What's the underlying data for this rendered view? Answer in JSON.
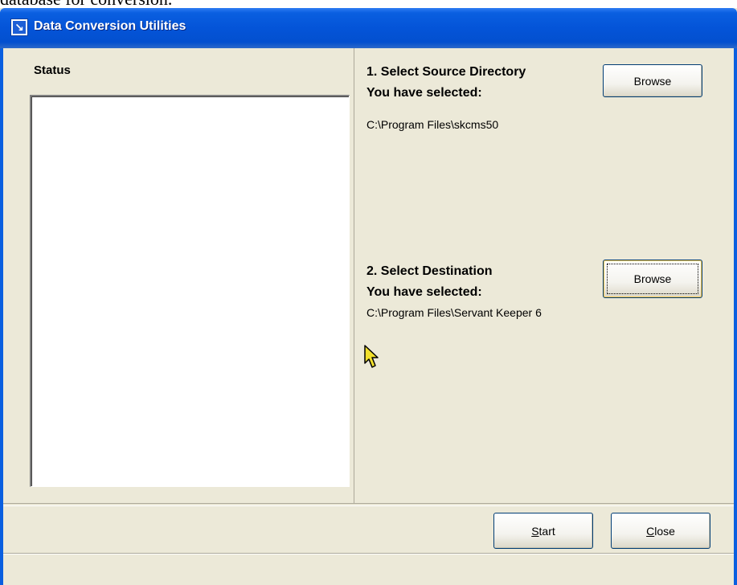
{
  "document": {
    "text_above": "database for conversion."
  },
  "window": {
    "title": "Data Conversion Utilities",
    "app_icon": "arrow-down-right-icon"
  },
  "status_panel": {
    "label": "Status",
    "content": ""
  },
  "source": {
    "heading": "1.  Select Source Directory",
    "selected_label": "You have selected:",
    "path": "C:\\Program Files\\skcms50",
    "browse_label": "Browse"
  },
  "destination": {
    "heading": "2.  Select Destination",
    "selected_label": "You have selected:",
    "path": "C:\\Program Files\\Servant Keeper 6",
    "browse_label": "Browse"
  },
  "footer": {
    "start_mnemonic": "S",
    "start_rest": "tart",
    "close_mnemonic": "C",
    "close_rest": "lose"
  },
  "colors": {
    "titlebar": "#0454d8",
    "face": "#ece9d8",
    "button_border": "#003c74"
  }
}
